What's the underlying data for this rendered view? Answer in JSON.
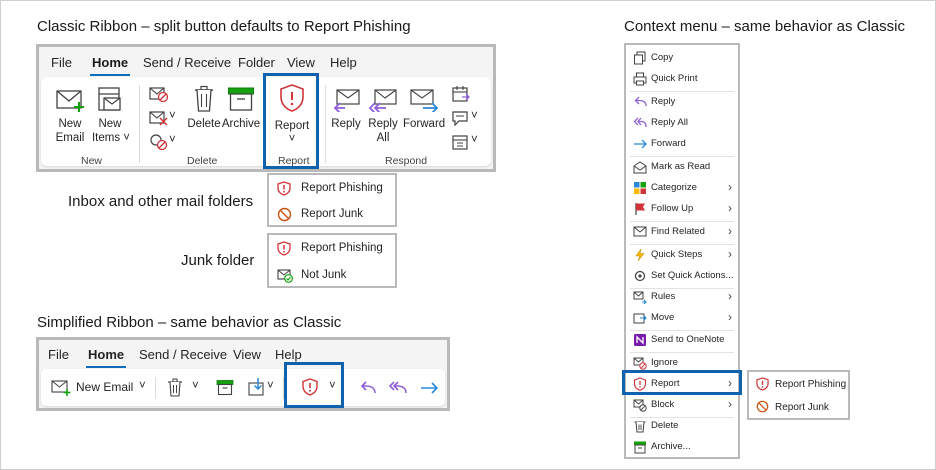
{
  "captions": {
    "classic": "Classic Ribbon – split button defaults to Report Phishing",
    "context": "Context menu – same behavior as Classic",
    "inbox": "Inbox and other mail folders",
    "junk": "Junk folder",
    "simplified": "Simplified Ribbon – same behavior as Classic"
  },
  "classic_ribbon": {
    "tabs": [
      "File",
      "Home",
      "Send / Receive",
      "Folder",
      "View",
      "Help"
    ],
    "active_tab": "Home",
    "buttons": {
      "new_email_1": "New",
      "new_email_2": "Email",
      "new_items_1": "New",
      "new_items_2": "Items ˅",
      "delete": "Delete",
      "archive": "Archive",
      "report": "Report",
      "report_caret": "˅",
      "reply": "Reply",
      "reply_all_1": "Reply",
      "reply_all_2": "All",
      "forward": "Forward",
      "small_caret": "˅"
    },
    "groups": {
      "new": "New",
      "delete": "Delete",
      "report": "Report",
      "respond": "Respond"
    }
  },
  "inbox_popup": {
    "items": [
      "Report Phishing",
      "Report Junk"
    ]
  },
  "junk_popup": {
    "items": [
      "Report Phishing",
      "Not Junk"
    ]
  },
  "simplified_ribbon": {
    "tabs": [
      "File",
      "Home",
      "Send / Receive",
      "View",
      "Help"
    ],
    "active_tab": "Home",
    "new_email": "New Email",
    "caret": "˅"
  },
  "context_menu": {
    "items": [
      {
        "label": "Copy",
        "icon": "copy-icon"
      },
      {
        "label": "Quick Print",
        "icon": "quick-print-icon"
      },
      {
        "label": "Reply",
        "icon": "reply-icon"
      },
      {
        "label": "Reply All",
        "icon": "reply-all-icon"
      },
      {
        "label": "Forward",
        "icon": "forward-icon"
      },
      {
        "label": "Mark as Read",
        "icon": "mark-read-icon"
      },
      {
        "label": "Categorize",
        "icon": "categorize-icon",
        "submenu": true
      },
      {
        "label": "Follow Up",
        "icon": "flag-icon",
        "submenu": true
      },
      {
        "label": "Find Related",
        "icon": "find-related-icon",
        "submenu": true
      },
      {
        "label": "Quick Steps",
        "icon": "quick-steps-icon",
        "submenu": true
      },
      {
        "label": "Set Quick Actions...",
        "icon": "quick-actions-icon"
      },
      {
        "label": "Rules",
        "icon": "rules-icon",
        "submenu": true
      },
      {
        "label": "Move",
        "icon": "move-icon",
        "submenu": true
      },
      {
        "label": "Send to OneNote",
        "icon": "onenote-icon"
      },
      {
        "label": "Ignore",
        "icon": "ignore-icon"
      },
      {
        "label": "Report",
        "icon": "report-shield-icon",
        "submenu": true
      },
      {
        "label": "Block",
        "icon": "block-icon",
        "submenu": true
      },
      {
        "label": "Delete",
        "icon": "delete-icon"
      },
      {
        "label": "Archive...",
        "icon": "archive-icon"
      }
    ],
    "arrow": "›"
  },
  "context_submenu": {
    "items": [
      "Report Phishing",
      "Report Junk"
    ]
  },
  "colors": {
    "highlight_blue": "#0f62ae",
    "accent_blue": "#0f6cbd",
    "phish_red": "#d13438",
    "junk_orange": "#ca5010",
    "reply_purple": "#8f5fd6",
    "forward_blue": "#2b88d8",
    "icon_gray": "#424242",
    "green": "#13a10e"
  }
}
